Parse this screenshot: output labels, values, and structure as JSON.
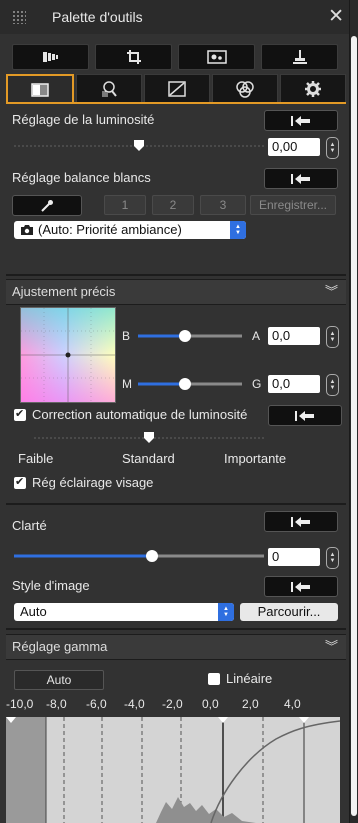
{
  "window": {
    "title": "Palette d'outils"
  },
  "toolbar": {
    "icons": [
      "film-strip-icon",
      "crop-icon",
      "image-icon",
      "stamp-icon"
    ]
  },
  "tabs": [
    {
      "icon": "brightness-square-icon",
      "active": true
    },
    {
      "icon": "zoom-grid-icon",
      "active": false
    },
    {
      "icon": "curve-icon",
      "active": false
    },
    {
      "icon": "color-circles-icon",
      "active": false
    },
    {
      "icon": "gear-icon",
      "active": false
    }
  ],
  "brightness": {
    "label": "Réglage de la luminosité",
    "value": "0,00",
    "slider_fraction": 0.5
  },
  "wb": {
    "label": "Réglage balance blancs",
    "presets": [
      "1",
      "2",
      "3"
    ],
    "save_label": "Enregistrer...",
    "mode": "(Auto: Priorité ambiance)"
  },
  "fine": {
    "title": "Ajustement précis",
    "b_label": "B",
    "a_label": "A",
    "ba_value": "0,0",
    "ba_fraction": 0.45,
    "m_label": "M",
    "g_label": "G",
    "mg_value": "0,0",
    "mg_fraction": 0.45,
    "auto_luminosity_label": "Correction automatique de luminosité",
    "auto_luminosity_checked": true,
    "level_labels": [
      "Faible",
      "Standard",
      "Importante"
    ],
    "level_fraction": 0.5,
    "face_label": "Rég éclairage visage",
    "face_checked": true
  },
  "clarity": {
    "label": "Clarté",
    "value": "0",
    "slider_fraction": 0.55
  },
  "style": {
    "label": "Style d'image",
    "value": "Auto",
    "browse_label": "Parcourir..."
  },
  "gamma": {
    "title": "Réglage gamma",
    "auto_label": "Auto",
    "linear_label": "Linéaire",
    "linear_checked": false,
    "ticks": [
      "-10,0",
      "-8,0",
      "-6,0",
      "-4,0",
      "-2,0",
      "0,0",
      "2,0",
      "4,0"
    ]
  },
  "colors": {
    "accent": "#e39a26",
    "slider_blue": "#2f6fe0"
  }
}
